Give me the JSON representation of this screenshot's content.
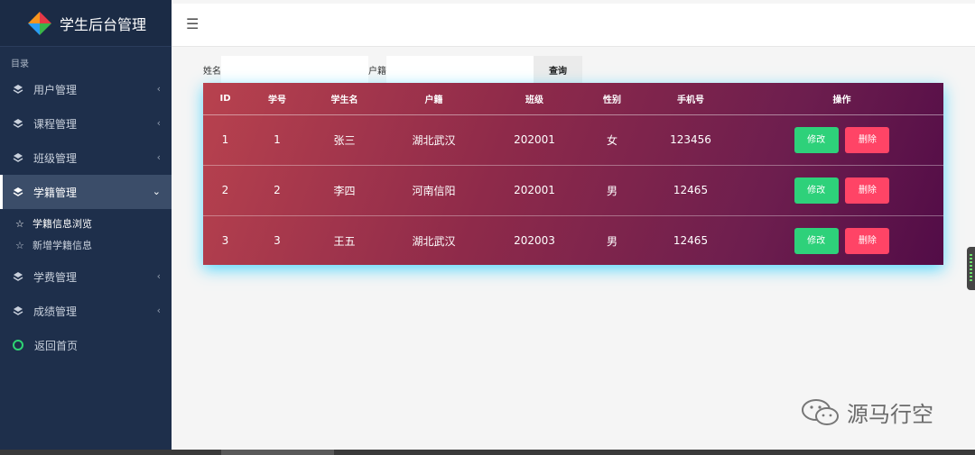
{
  "sidebar": {
    "title": "学生后台管理",
    "section_label": "目录",
    "items": [
      {
        "label": "用户管理",
        "icon": "layers-icon"
      },
      {
        "label": "课程管理",
        "icon": "layers-icon"
      },
      {
        "label": "班级管理",
        "icon": "layers-icon"
      },
      {
        "label": "学籍管理",
        "icon": "layers-icon",
        "active": true
      },
      {
        "label": "学费管理",
        "icon": "layers-icon"
      },
      {
        "label": "成绩管理",
        "icon": "layers-icon"
      },
      {
        "label": "返回首页",
        "icon": "circle-icon"
      }
    ],
    "subitems": [
      {
        "label": "学籍信息浏览",
        "icon": "star-filled-icon"
      },
      {
        "label": "新增学籍信息",
        "icon": "star-outline-icon"
      }
    ]
  },
  "search": {
    "name_label": "姓名",
    "name_value": "",
    "home_label": "户籍",
    "home_value": "",
    "query_label": "查询"
  },
  "table": {
    "headers": [
      "ID",
      "学号",
      "学生名",
      "户籍",
      "班级",
      "性别",
      "手机号",
      "操作"
    ],
    "rows": [
      [
        "1",
        "1",
        "张三",
        "湖北武汉",
        "202001",
        "女",
        "123456"
      ],
      [
        "2",
        "2",
        "李四",
        "河南信阳",
        "202001",
        "男",
        "12465"
      ],
      [
        "3",
        "3",
        "王五",
        "湖北武汉",
        "202003",
        "男",
        "12465"
      ]
    ],
    "edit_label": "修改",
    "delete_label": "删除"
  },
  "watermark": {
    "text": "源马行空"
  },
  "colors": {
    "sidebar_bg": "#1e2f4b",
    "edit_button": "#2ed17a",
    "delete_button": "#ff4466",
    "table_glow": "#40d4ff"
  }
}
